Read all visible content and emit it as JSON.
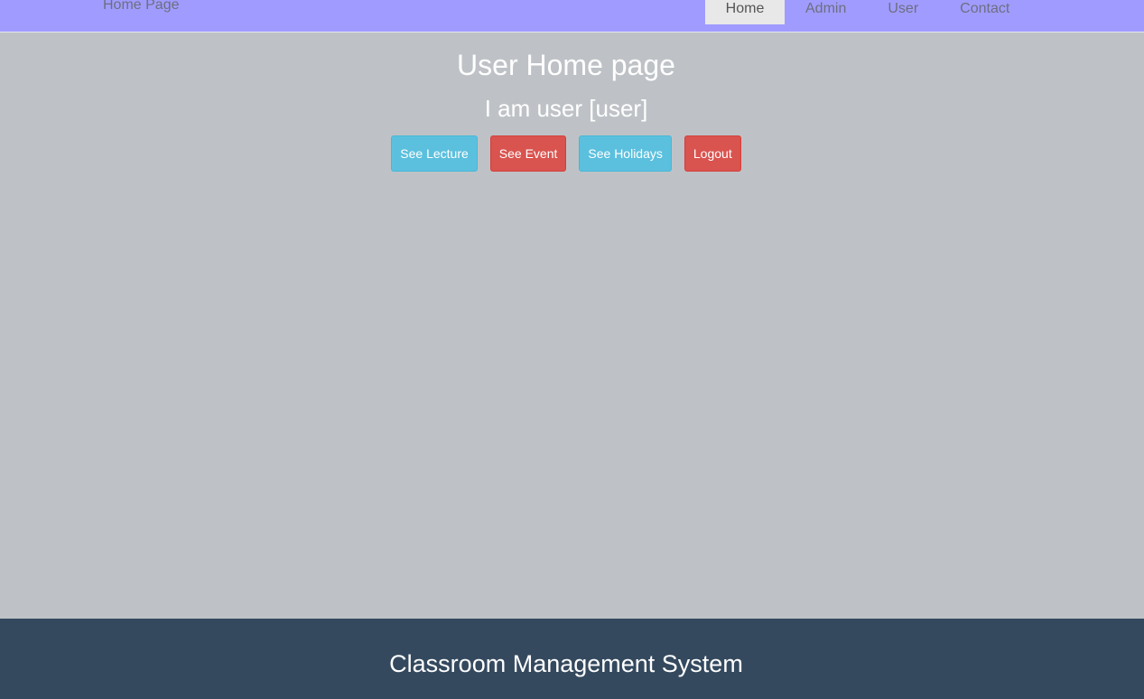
{
  "navbar": {
    "brand": "Home Page",
    "items": [
      {
        "label": "Home",
        "active": true
      },
      {
        "label": "Admin",
        "active": false
      },
      {
        "label": "User",
        "active": false
      },
      {
        "label": "Contact",
        "active": false
      }
    ]
  },
  "main": {
    "title": "User Home page",
    "subtitle": "I am user [user]",
    "buttons": [
      {
        "label": "See Lecture",
        "style": "info"
      },
      {
        "label": "See Event",
        "style": "danger"
      },
      {
        "label": "See Holidays",
        "style": "info"
      },
      {
        "label": "Logout",
        "style": "danger"
      }
    ]
  },
  "footer": {
    "title": "Classroom Management System"
  },
  "colors": {
    "navbar_bg": "#a09cff",
    "page_bg": "#bec2c6",
    "footer_bg": "#34495e",
    "info": "#5bc0de",
    "danger": "#d9534f"
  }
}
